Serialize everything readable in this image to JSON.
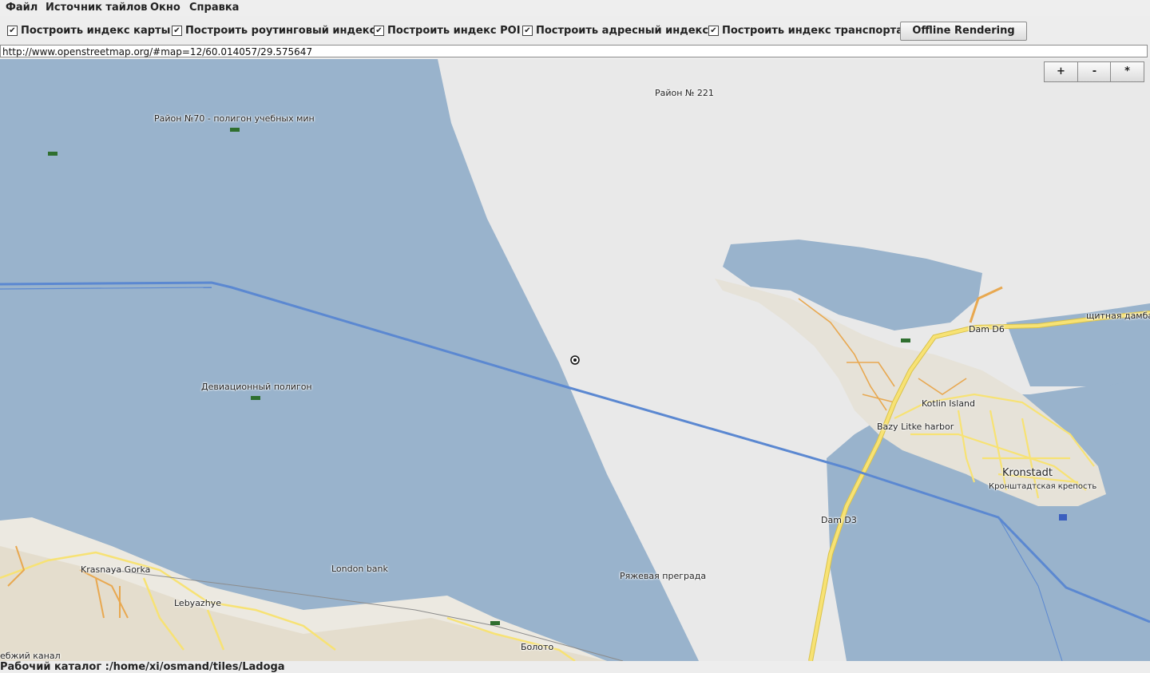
{
  "menu": [
    "Файл",
    "Источник тайлов",
    "Окно",
    "Справка"
  ],
  "toolbar": {
    "checkboxes": [
      {
        "label": "Построить индекс карты",
        "checked": true
      },
      {
        "label": "Построить роутинговый индекс",
        "checked": true
      },
      {
        "label": "Построить индекс POI",
        "checked": true
      },
      {
        "label": "Построить адресный индекс",
        "checked": true
      },
      {
        "label": "Построить индекс транспорта",
        "checked": true
      }
    ],
    "offline_button": "Offline Rendering"
  },
  "url": "http://www.openstreetmap.org/#map=12/60.014057/29.575647",
  "zoom": {
    "plus": "+",
    "minus": "-",
    "star": "*"
  },
  "map_labels": [
    "Район № 221",
    "Район №70 - полигон учебных мин",
    "Девиационный полигон",
    "щитная дамба",
    "Dam D6",
    "Kotlin Island",
    "Bazy Litke harbor",
    "Kronstadt",
    "Кронштадтская крепость",
    "Dam D3",
    "Krasnaya Gorka",
    "London bank",
    "Ряжевая преграда",
    "Lebyazhye",
    "Болото",
    "ебжий канал"
  ],
  "colors": {
    "water": "#99b3cc",
    "land": "#e9e9e9",
    "road": "#f7e274",
    "road_minor": "#e8a850",
    "route_line": "#5b88d1"
  },
  "status": "Рабочий каталог :/home/xi/osmand/tiles/Ladoga"
}
